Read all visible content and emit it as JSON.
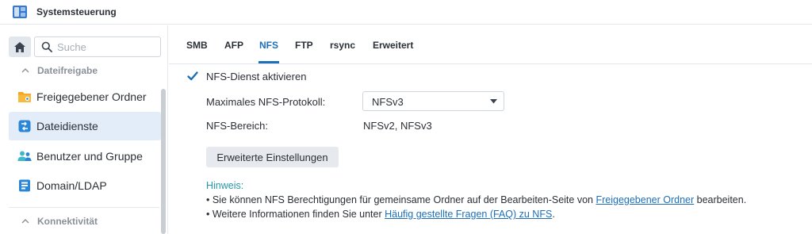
{
  "window": {
    "title": "Systemsteuerung"
  },
  "sidebar": {
    "search_placeholder": "Suche",
    "sections": [
      {
        "label": "Dateifreigabe"
      },
      {
        "label": "Konnektivität"
      }
    ],
    "items": [
      {
        "label": "Freigegebener Ordner",
        "icon": "folder-share-icon",
        "color": "#f5a623"
      },
      {
        "label": "Dateidienste",
        "icon": "file-services-icon",
        "color": "#2a86d6",
        "active": true
      },
      {
        "label": "Benutzer und Gruppe",
        "icon": "users-icon",
        "color": "#3fb8c9"
      },
      {
        "label": "Domain/LDAP",
        "icon": "domain-icon",
        "color": "#2a86d6"
      }
    ]
  },
  "tabs": [
    {
      "label": "SMB"
    },
    {
      "label": "AFP"
    },
    {
      "label": "NFS",
      "active": true
    },
    {
      "label": "FTP"
    },
    {
      "label": "rsync"
    },
    {
      "label": "Erweitert"
    }
  ],
  "nfs": {
    "enable_label": "NFS-Dienst aktivieren",
    "enable_checked": true,
    "max_protocol_label": "Maximales NFS-Protokoll:",
    "max_protocol_value": "NFSv3",
    "range_label": "NFS-Bereich:",
    "range_value": "NFSv2, NFSv3",
    "advanced_button": "Erweiterte Einstellungen"
  },
  "hint": {
    "title": "Hinweis:",
    "line1_prefix": "• Sie können NFS Berechtigungen für gemeinsame Ordner auf der Bearbeiten-Seite von ",
    "line1_link": "Freigegebener Ordner",
    "line1_suffix": " bearbeiten.",
    "line2_prefix": "• Weitere Informationen finden Sie unter ",
    "line2_link": "Häufig gestellte Fragen (FAQ) zu NFS",
    "line2_suffix": "."
  },
  "colors": {
    "accent": "#1d6fb8",
    "hint": "#2597a7",
    "active_bg": "#e3edf9"
  }
}
